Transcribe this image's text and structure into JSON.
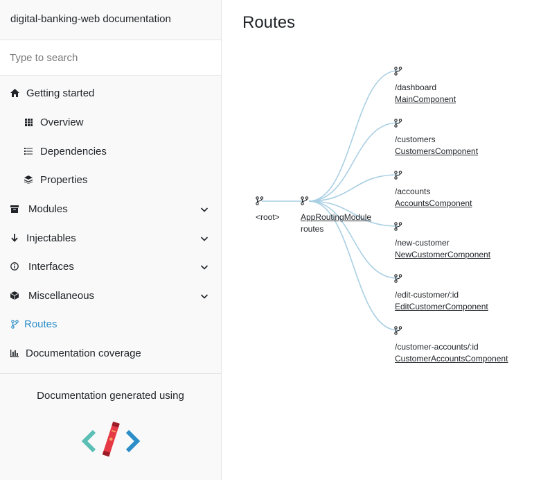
{
  "sidebar": {
    "title": "digital-banking-web documentation",
    "search_placeholder": "Type to search",
    "items": [
      {
        "label": "Getting started",
        "icon": "home-icon"
      },
      {
        "label": "Overview",
        "icon": "grid-icon"
      },
      {
        "label": "Dependencies",
        "icon": "list-icon"
      },
      {
        "label": "Properties",
        "icon": "layers-icon"
      },
      {
        "label": "Modules",
        "icon": "archive-icon"
      },
      {
        "label": "Injectables",
        "icon": "arrow-down-icon"
      },
      {
        "label": "Interfaces",
        "icon": "info-icon"
      },
      {
        "label": "Miscellaneous",
        "icon": "cube-icon"
      },
      {
        "label": "Routes",
        "icon": "branch-icon"
      },
      {
        "label": "Documentation coverage",
        "icon": "bar-chart-icon"
      }
    ],
    "generated_label": "Documentation generated using"
  },
  "main": {
    "title": "Routes",
    "root_label": "<root>",
    "module": {
      "name": "AppRoutingModule",
      "sub": "routes"
    },
    "routes": [
      {
        "path": "/dashboard",
        "component": "MainComponent"
      },
      {
        "path": "/customers",
        "component": "CustomersComponent"
      },
      {
        "path": "/accounts",
        "component": "AccountsComponent"
      },
      {
        "path": "/new-customer",
        "component": "NewCustomerComponent"
      },
      {
        "path": "/edit-customer/:id",
        "component": "EditCustomerComponent"
      },
      {
        "path": "/customer-accounts/:id",
        "component": "CustomerAccountsComponent"
      }
    ]
  },
  "colors": {
    "accent": "#2c8ec9",
    "link_curve": "#a9cfe3"
  }
}
